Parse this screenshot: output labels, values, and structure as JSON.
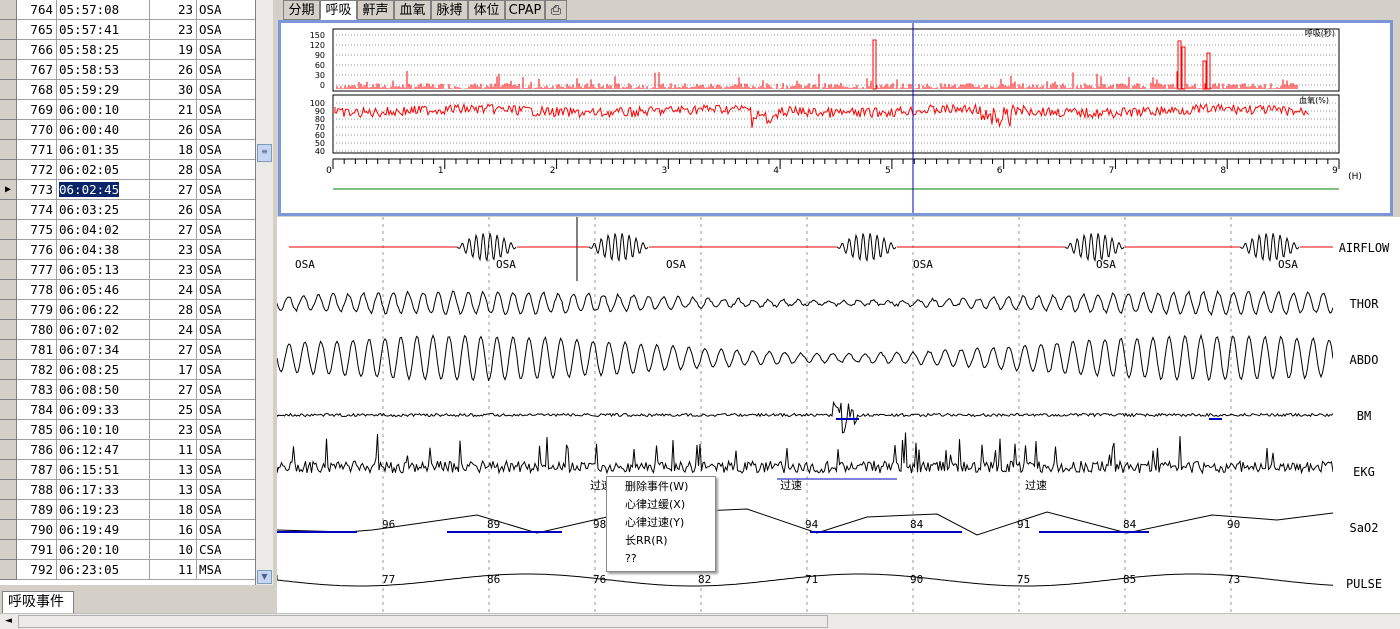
{
  "event_list": {
    "rows": [
      {
        "no": "764",
        "time": "05:57:08",
        "dur": "23",
        "type": "OSA"
      },
      {
        "no": "765",
        "time": "05:57:41",
        "dur": "23",
        "type": "OSA"
      },
      {
        "no": "766",
        "time": "05:58:25",
        "dur": "19",
        "type": "OSA"
      },
      {
        "no": "767",
        "time": "05:58:53",
        "dur": "26",
        "type": "OSA"
      },
      {
        "no": "768",
        "time": "05:59:29",
        "dur": "30",
        "type": "OSA"
      },
      {
        "no": "769",
        "time": "06:00:10",
        "dur": "21",
        "type": "OSA"
      },
      {
        "no": "770",
        "time": "06:00:40",
        "dur": "26",
        "type": "OSA"
      },
      {
        "no": "771",
        "time": "06:01:35",
        "dur": "18",
        "type": "OSA"
      },
      {
        "no": "772",
        "time": "06:02:05",
        "dur": "28",
        "type": "OSA"
      },
      {
        "no": "773",
        "time": "06:02:45",
        "dur": "27",
        "type": "OSA"
      },
      {
        "no": "774",
        "time": "06:03:25",
        "dur": "26",
        "type": "OSA"
      },
      {
        "no": "775",
        "time": "06:04:02",
        "dur": "27",
        "type": "OSA"
      },
      {
        "no": "776",
        "time": "06:04:38",
        "dur": "23",
        "type": "OSA"
      },
      {
        "no": "777",
        "time": "06:05:13",
        "dur": "23",
        "type": "OSA"
      },
      {
        "no": "778",
        "time": "06:05:46",
        "dur": "24",
        "type": "OSA"
      },
      {
        "no": "779",
        "time": "06:06:22",
        "dur": "28",
        "type": "OSA"
      },
      {
        "no": "780",
        "time": "06:07:02",
        "dur": "24",
        "type": "OSA"
      },
      {
        "no": "781",
        "time": "06:07:34",
        "dur": "27",
        "type": "OSA"
      },
      {
        "no": "782",
        "time": "06:08:25",
        "dur": "17",
        "type": "OSA"
      },
      {
        "no": "783",
        "time": "06:08:50",
        "dur": "27",
        "type": "OSA"
      },
      {
        "no": "784",
        "time": "06:09:33",
        "dur": "25",
        "type": "OSA"
      },
      {
        "no": "785",
        "time": "06:10:10",
        "dur": "23",
        "type": "OSA"
      },
      {
        "no": "786",
        "time": "06:12:47",
        "dur": "11",
        "type": "OSA"
      },
      {
        "no": "787",
        "time": "06:15:51",
        "dur": "13",
        "type": "OSA"
      },
      {
        "no": "788",
        "time": "06:17:33",
        "dur": "13",
        "type": "OSA"
      },
      {
        "no": "789",
        "time": "06:19:23",
        "dur": "18",
        "type": "OSA"
      },
      {
        "no": "790",
        "time": "06:19:49",
        "dur": "16",
        "type": "OSA"
      },
      {
        "no": "791",
        "time": "06:20:10",
        "dur": "10",
        "type": "CSA"
      },
      {
        "no": "792",
        "time": "06:23:05",
        "dur": "11",
        "type": "MSA"
      }
    ],
    "selected_row": "773",
    "tab_label": "呼吸事件"
  },
  "overview": {
    "tabs": [
      "分期",
      "呼吸",
      "鼾声",
      "血氧",
      "脉搏",
      "体位",
      "CPAP"
    ],
    "active_tab": "呼吸",
    "resp_label": "呼吸(秒)",
    "resp_ticks": [
      "150",
      "120",
      "90",
      "60",
      "30",
      "0"
    ],
    "spo2_label": "血氧(%)",
    "spo2_ticks": [
      "100",
      "90",
      "80",
      "70",
      "60",
      "50",
      "40"
    ],
    "hour_ticks": [
      "0",
      "1",
      "2",
      "3",
      "4",
      "5",
      "6",
      "7",
      "8",
      "9"
    ],
    "hour_unit": "(H)"
  },
  "channels": [
    "AIRFLOW",
    "THOR",
    "ABDO",
    "BM",
    "EKG",
    "SaO2",
    "PULSE"
  ],
  "airflow_events": [
    "OSA",
    "OSA",
    "OSA",
    "OSA",
    "OSA",
    "OSA"
  ],
  "ekg_events": [
    "过速",
    "过速",
    "过速"
  ],
  "sao2_values": [
    "96",
    "89",
    "98",
    "94",
    "84",
    "91",
    "84",
    "90"
  ],
  "pulse_values": [
    "77",
    "86",
    "76",
    "82",
    "71",
    "90",
    "75",
    "85",
    "73"
  ],
  "context_menu": {
    "items": [
      "删除事件(W)",
      "心律过缓(X)",
      "心律过速(Y)",
      "长RR(R)",
      "??"
    ]
  }
}
